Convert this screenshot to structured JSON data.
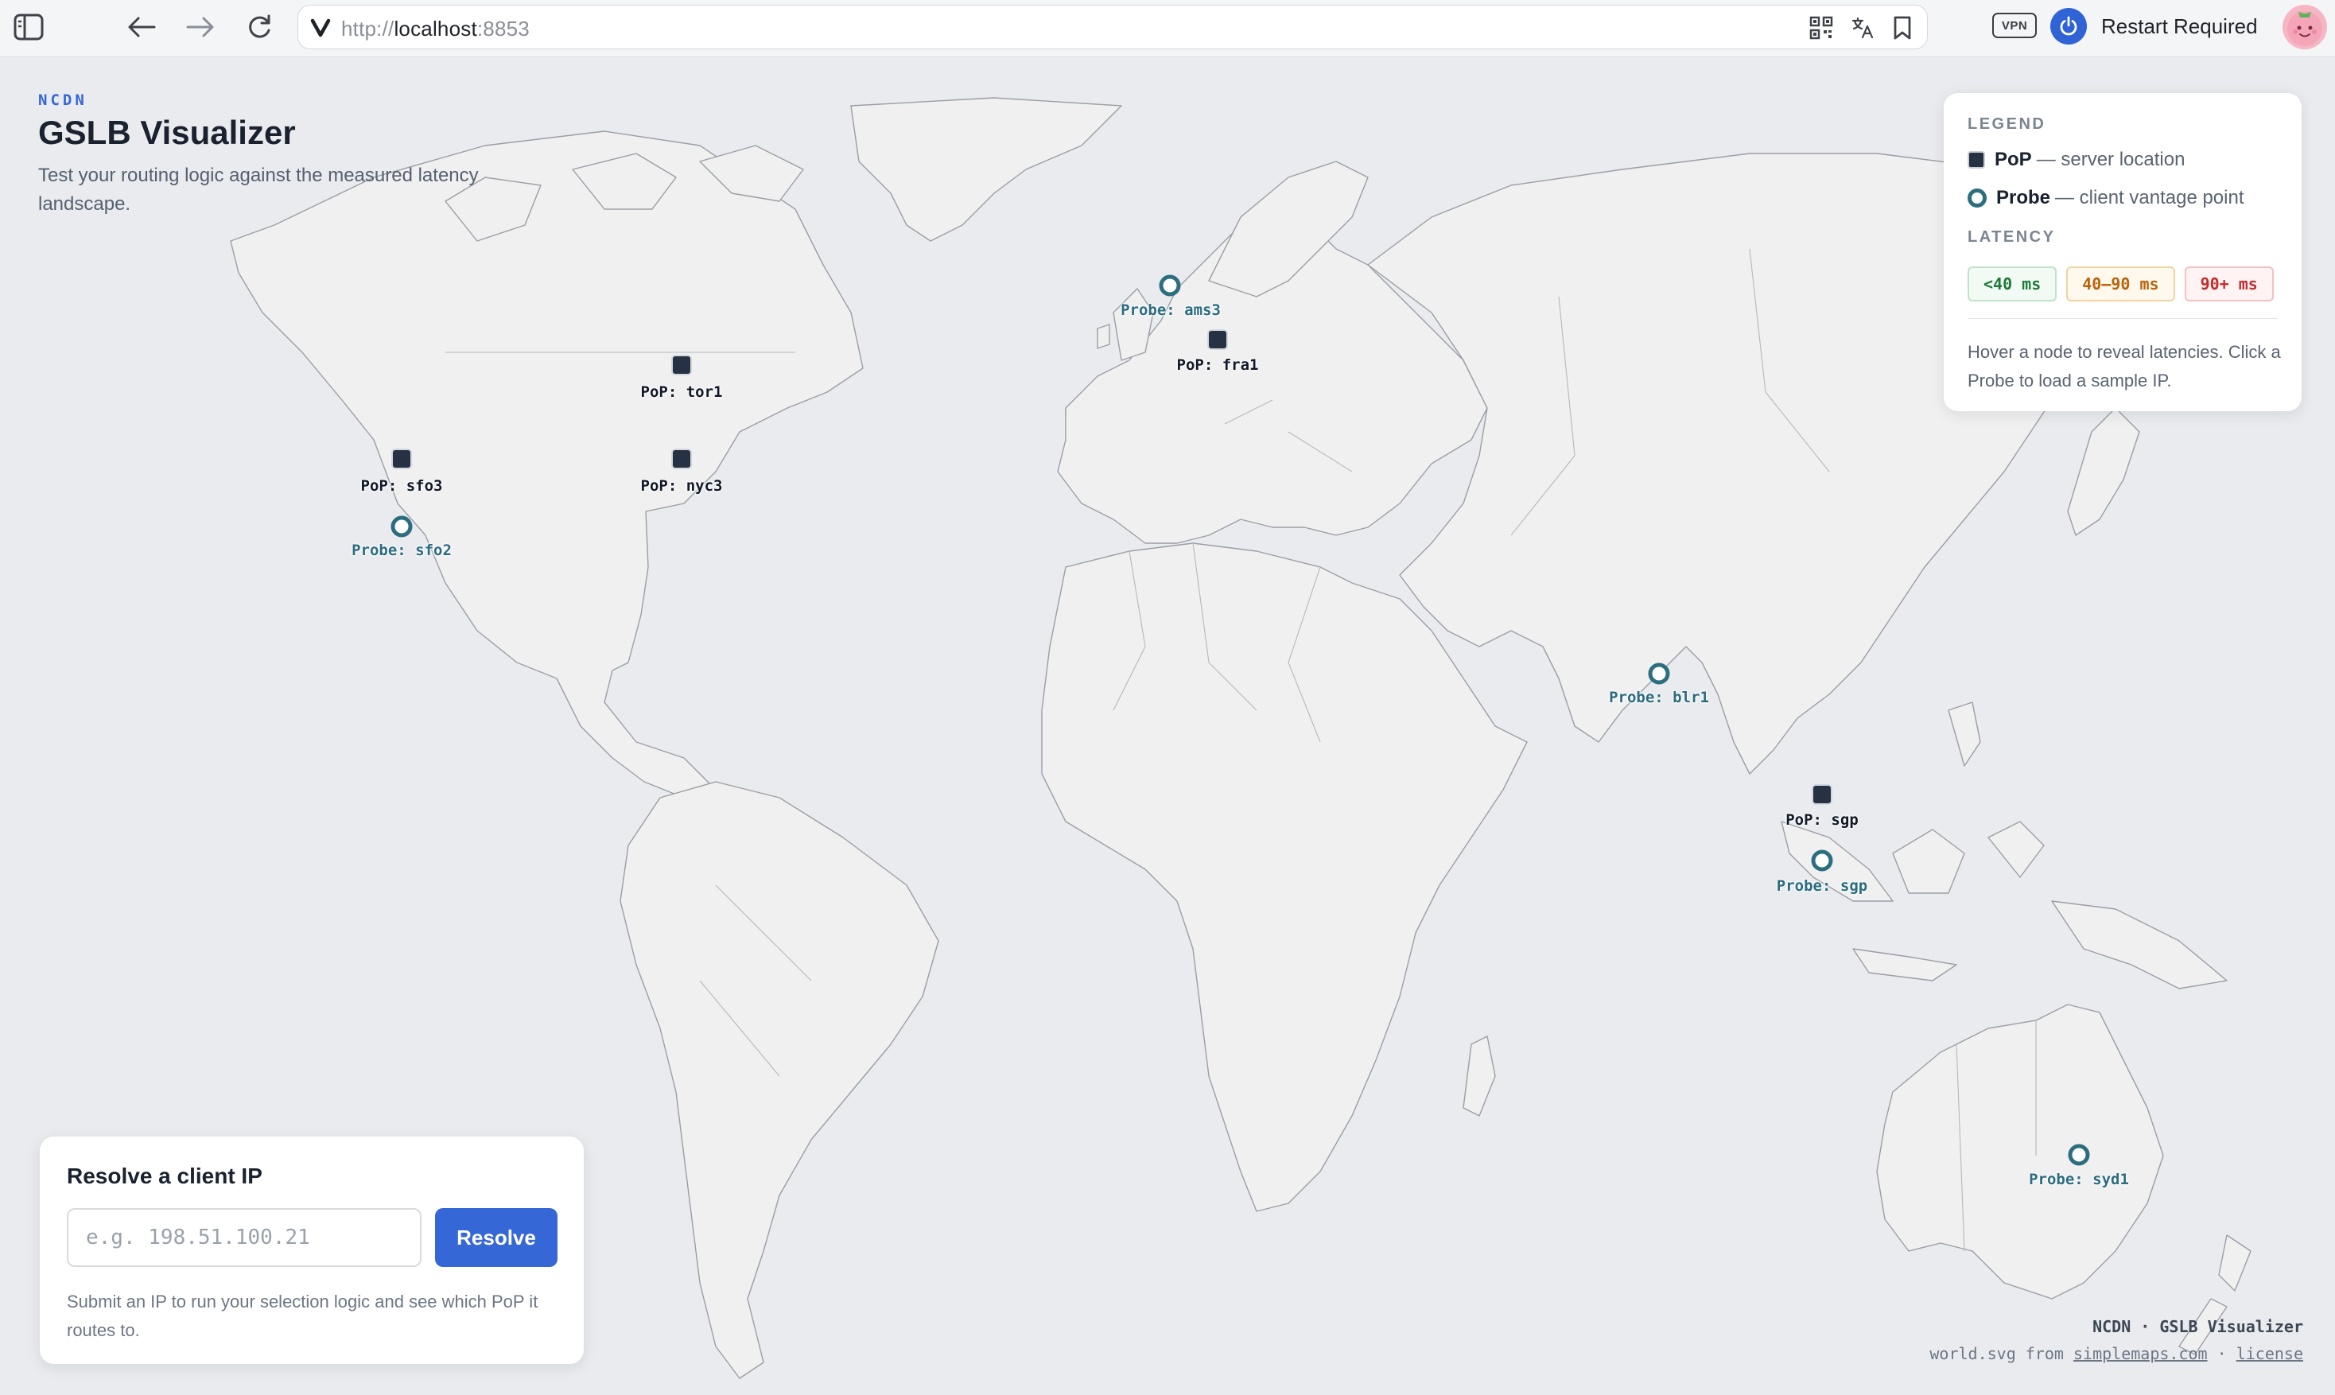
{
  "browser": {
    "url_scheme": "http://",
    "url_host": "localhost",
    "url_port": ":8853",
    "vpn_label": "VPN",
    "restart_label": "Restart Required"
  },
  "header": {
    "eyebrow": "NCDN",
    "title": "GSLB Visualizer",
    "subtitle": "Test your routing logic against the measured latency landscape."
  },
  "legend": {
    "heading": "LEGEND",
    "pop_label": "PoP",
    "pop_desc": "— server location",
    "probe_label": "Probe",
    "probe_desc": "— client vantage point",
    "latency_heading": "LATENCY",
    "chips": [
      "<40 ms",
      "40–90 ms",
      "90+ ms"
    ],
    "hint": "Hover a node to reveal latencies. Click a Probe to load a sample IP."
  },
  "nodes": [
    {
      "kind": "probe",
      "label": "Probe: ams3"
    },
    {
      "kind": "pop",
      "label": "PoP: fra1"
    },
    {
      "kind": "pop",
      "label": "PoP: tor1"
    },
    {
      "kind": "pop",
      "label": "PoP: sfo3"
    },
    {
      "kind": "pop",
      "label": "PoP: nyc3"
    },
    {
      "kind": "probe",
      "label": "Probe: sfo2"
    },
    {
      "kind": "probe",
      "label": "Probe: blr1"
    },
    {
      "kind": "pop",
      "label": "PoP: sgp"
    },
    {
      "kind": "probe",
      "label": "Probe: sgp"
    },
    {
      "kind": "probe",
      "label": "Probe: syd1"
    }
  ],
  "resolve": {
    "title": "Resolve a client IP",
    "placeholder": "e.g. 198.51.100.21",
    "button": "Resolve",
    "help": "Submit an IP to run your selection logic and see which PoP it routes to."
  },
  "footer": {
    "brand": "NCDN · GSLB Visualizer",
    "source_prefix": "world.svg from",
    "source_link": "simplemaps.com",
    "separator": "·",
    "license": "license"
  },
  "colors": {
    "accent": "#3567d6",
    "pop": "#263244",
    "probe": "#2c6e7f",
    "good": "#1f7a3a",
    "mid": "#b8640c",
    "bad": "#c22b2b"
  }
}
